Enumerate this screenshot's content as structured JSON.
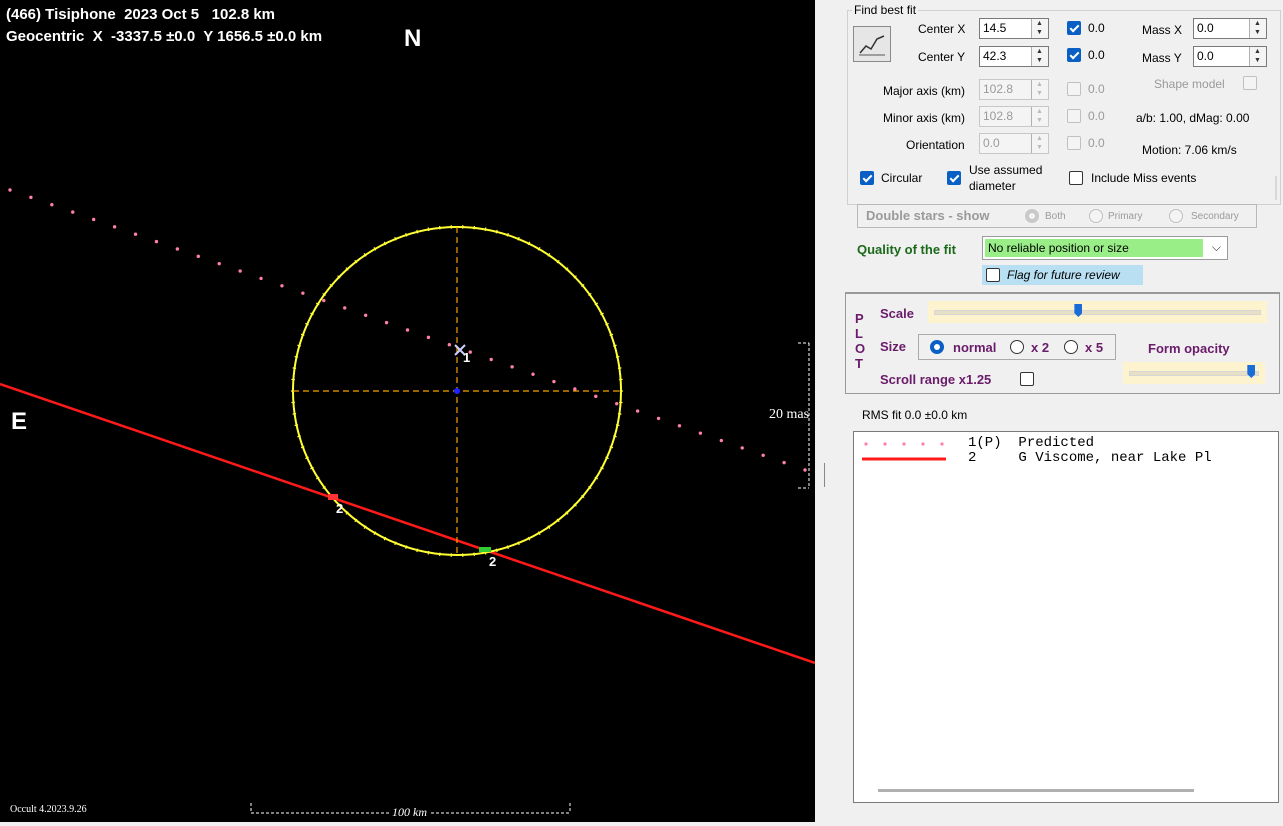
{
  "plot": {
    "title_line1": "(466) Tisiphone  2023 Oct 5   102.8 km",
    "title_line2": "Geocentric  X  -3337.5 ±0.0  Y 1656.5 ±0.0 km",
    "north": "N",
    "east": "E",
    "footer": "Occult 4.2023.9.26",
    "scale_label": "100 km",
    "mas_label": "20 mas",
    "chord_labels": {
      "predicted": "1",
      "observer_a": "2",
      "observer_b": "2"
    },
    "colors": {
      "background": "#000000",
      "ellipse": "#ffff33",
      "axes": "#f5a000",
      "predicted": "#ff7faa",
      "chord": "#ff1a1a"
    }
  },
  "find_best_fit": {
    "title": "Find best fit",
    "fit_icon": "best-fit-chart-icon",
    "center_x": {
      "label": "Center X",
      "value": "14.5",
      "fix_checked": true,
      "uncert": "0.0"
    },
    "center_y": {
      "label": "Center Y",
      "value": "42.3",
      "fix_checked": true,
      "uncert": "0.0"
    },
    "mass_x": {
      "label": "Mass X",
      "value": "0.0"
    },
    "mass_y": {
      "label": "Mass Y",
      "value": "0.0"
    },
    "major_axis": {
      "label": "Major axis (km)",
      "value": "102.8",
      "uncert": "0.0"
    },
    "minor_axis": {
      "label": "Minor axis (km)",
      "value": "102.8",
      "uncert": "0.0"
    },
    "orientation": {
      "label": "Orientation",
      "value": "0.0",
      "uncert": "0.0"
    },
    "shape_model": "Shape model",
    "ab_dmag": "a/b: 1.00, dMag: 0.00",
    "motion": "Motion: 7.06 km/s",
    "circular": {
      "label": "Circular",
      "checked": true
    },
    "use_assumed": {
      "label_line1": "Use assumed",
      "label_line2": "diameter",
      "checked": true
    },
    "include_miss": {
      "label": "Include Miss events",
      "checked": false
    },
    "double_stars": {
      "label": "Double stars - show",
      "options": [
        "Both",
        "Primary",
        "Secondary"
      ],
      "selected": "Both"
    },
    "quality": {
      "label": "Quality of the fit",
      "value": "No reliable position or size",
      "color": "#99ee88"
    },
    "flag_review": {
      "label": "Flag for future review",
      "checked": false
    }
  },
  "plot_controls": {
    "vertical_label": [
      "P",
      "L",
      "O",
      "T"
    ],
    "scale_label": "Scale",
    "scale_level": 0.44,
    "size_label": "Size",
    "size_options": [
      "normal",
      "x 2",
      "x 5"
    ],
    "size_selected": "normal",
    "form_opacity": "Form opacity",
    "opacity_level": 0.97,
    "scroll_range": "Scroll range x1.25",
    "scroll_checked": false
  },
  "rms": "RMS fit  0.0 ±0.0 km",
  "legend": [
    {
      "num": "1(P)",
      "name": "Predicted",
      "style": "dotted",
      "color": "#ff7faa"
    },
    {
      "num": "2",
      "name": "G Viscome, near Lake Pl",
      "style": "solid",
      "color": "#ff1a1a"
    }
  ]
}
